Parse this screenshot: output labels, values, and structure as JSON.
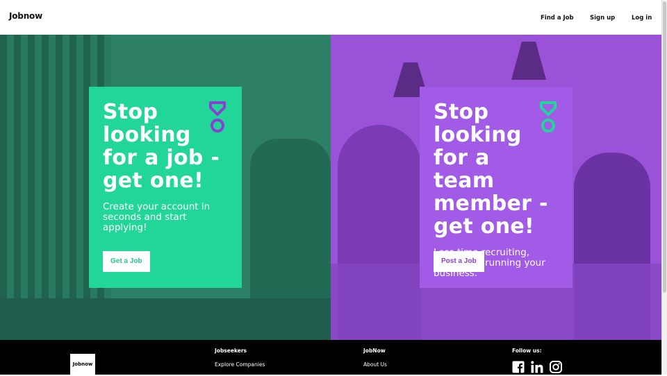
{
  "header": {
    "logo": "Jobnow",
    "nav": [
      {
        "label": "Find a Job"
      },
      {
        "label": "Sign up"
      },
      {
        "label": "Log in"
      }
    ]
  },
  "hero": {
    "jobseeker": {
      "headline": "Stop looking for a job - get one!",
      "subtext": "Create your account in seconds and start applying!",
      "button": "Get a Job",
      "card_color": "#22d69a",
      "bg_color": "#2d7f66"
    },
    "employer": {
      "headline": "Stop looking for a team member - get one!",
      "subtext": "Less time recruiting, more time running your business.",
      "button": "Post a Job",
      "card_color": "#a25be7",
      "bg_color": "#9a52d8"
    }
  },
  "footer": {
    "logo": "Jobnow",
    "columns": [
      {
        "heading": "Jobseekers",
        "links": [
          "Explore Companies"
        ]
      },
      {
        "heading": "JobNow",
        "links": [
          "About Us"
        ]
      }
    ],
    "follow_heading": "Follow us:",
    "social_icons": [
      "facebook-icon",
      "linkedin-icon",
      "instagram-icon"
    ]
  }
}
